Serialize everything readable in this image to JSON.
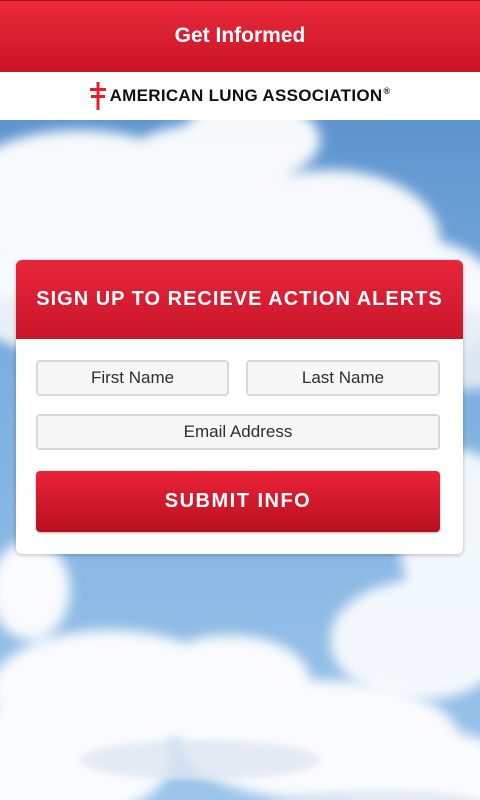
{
  "titlebar": {
    "title": "Get Informed"
  },
  "brand": {
    "name": "AMERICAN LUNG ASSOCIATION",
    "registered": "®",
    "logo_icon": "double-cross-icon",
    "logo_color": "#e41e30"
  },
  "form": {
    "header": "SIGN UP TO RECIEVE ACTION ALERTS",
    "first_name_placeholder": "First Name",
    "last_name_placeholder": "Last Name",
    "email_placeholder": "Email Address",
    "submit_label": "SUBMIT INFO"
  },
  "colors": {
    "accent": "#d91a2e",
    "sky": "#6fa0d4"
  }
}
